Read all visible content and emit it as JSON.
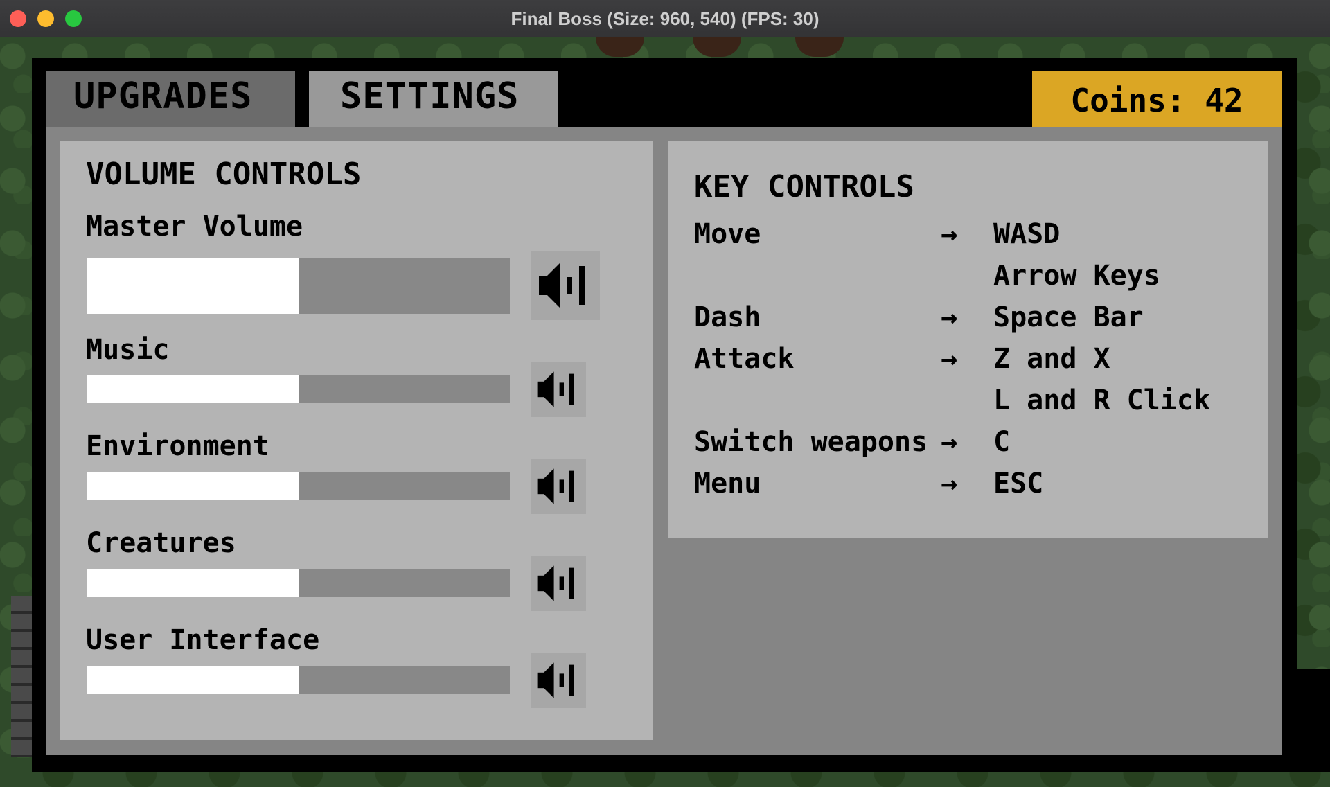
{
  "window": {
    "title": "Final Boss (Size: 960, 540) (FPS: 30)"
  },
  "tabs": {
    "upgrades": "UPGRADES",
    "settings": "SETTINGS"
  },
  "coins": {
    "label": "Coins: 42"
  },
  "volume": {
    "heading": "VOLUME CONTROLS",
    "sliders": [
      {
        "label": "Master Volume",
        "level": 0.5,
        "icon": "speaker-volume-icon"
      },
      {
        "label": "Music",
        "level": 0.5,
        "icon": "speaker-volume-icon"
      },
      {
        "label": "Environment",
        "level": 0.5,
        "icon": "speaker-volume-icon"
      },
      {
        "label": "Creatures",
        "level": 0.5,
        "icon": "speaker-volume-icon"
      },
      {
        "label": "User Interface",
        "level": 0.5,
        "icon": "speaker-volume-icon"
      }
    ]
  },
  "keys": {
    "heading": "KEY CONTROLS",
    "arrow": "→",
    "rows": [
      {
        "action": "Move",
        "keys": [
          "WASD",
          "Arrow Keys"
        ]
      },
      {
        "action": "Dash",
        "keys": [
          "Space Bar"
        ]
      },
      {
        "action": "Attack",
        "keys": [
          "Z and X",
          "L and R Click"
        ]
      },
      {
        "action": "Switch weapons",
        "keys": [
          "C"
        ]
      },
      {
        "action": "Menu",
        "keys": [
          "ESC"
        ]
      }
    ]
  },
  "colors": {
    "coins_bg": "#dba624",
    "panel_bg": "#b4b4b4",
    "frame_bg": "#858585",
    "slider_fill": "#ffffff",
    "slider_track": "#888888"
  }
}
